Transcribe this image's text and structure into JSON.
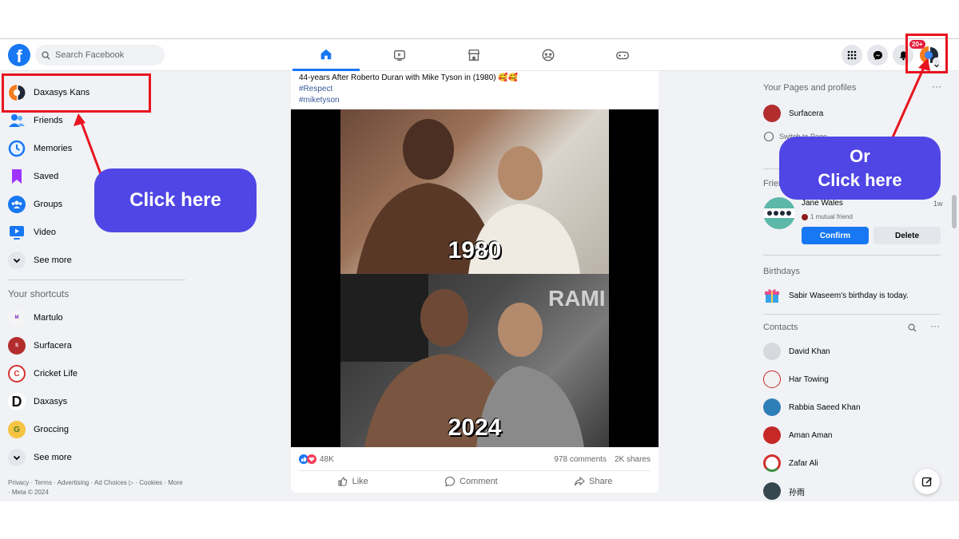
{
  "header": {
    "logo": "f",
    "search_placeholder": "Search Facebook",
    "notification_badge": "20+"
  },
  "sidebar": {
    "profile_name": "Daxasys Kans",
    "items": [
      {
        "label": "Friends",
        "icon": "friends-icon"
      },
      {
        "label": "Memories",
        "icon": "clock-icon"
      },
      {
        "label": "Saved",
        "icon": "bookmark-icon"
      },
      {
        "label": "Groups",
        "icon": "groups-icon"
      },
      {
        "label": "Video",
        "icon": "video-icon"
      }
    ],
    "see_more": "See more",
    "shortcuts_title": "Your shortcuts",
    "shortcuts": [
      {
        "label": "Martulo",
        "color": "#f4f4f4"
      },
      {
        "label": "Surfacera",
        "color": "#b32d2e"
      },
      {
        "label": "Cricket Life",
        "color": "#d63232"
      },
      {
        "label": "Daxasys",
        "color": "#ffffff"
      },
      {
        "label": "Groccing",
        "color": "#f6c342"
      }
    ],
    "see_more_2": "See more",
    "footer": "Privacy · Terms · Advertising · Ad Choices ▷ · Cookies · More · Meta © 2024"
  },
  "post": {
    "text": "44-years After Roberto Duran with Mike Tyson in (1980) 🥰🥰",
    "tags": [
      "#Respect",
      "#miketyson"
    ],
    "years": [
      "1980",
      "2024"
    ],
    "reactions": "48K",
    "comments": "978 comments",
    "shares": "2K shares",
    "actions": {
      "like": "Like",
      "comment": "Comment",
      "share": "Share"
    }
  },
  "rightbar": {
    "pages_title": "Your Pages and profiles",
    "page_name": "Surfacera",
    "switch_to_page": "Switch to Page",
    "friends_title": "Friend requests",
    "request": {
      "name": "Jane Wales",
      "time": "1w",
      "mutual": "1 mutual friend",
      "confirm": "Confirm",
      "delete": "Delete"
    },
    "birthdays_title": "Birthdays",
    "birthday_name": "Sabir Waseem",
    "birthday_text": "'s birthday is today.",
    "contacts_title": "Contacts",
    "contacts": [
      {
        "name": "David Khan",
        "color": "#d5d8dc"
      },
      {
        "name": "Har Towing",
        "color": "#f1f1f1"
      },
      {
        "name": "Rabbia Saeed Khan",
        "color": "#2e7fb8"
      },
      {
        "name": "Aman Aman",
        "color": "#c62828"
      },
      {
        "name": "Zafar Ali",
        "color": "#ffffff"
      },
      {
        "name": "孙雨",
        "color": "#37474f"
      }
    ]
  },
  "annotations": {
    "callout_left": "Click here",
    "callout_right_line1": "Or",
    "callout_right_line2": "Click here"
  },
  "colors": {
    "accent": "#1877f2",
    "callout": "#4f46e5",
    "highlight": "#e8141f"
  }
}
